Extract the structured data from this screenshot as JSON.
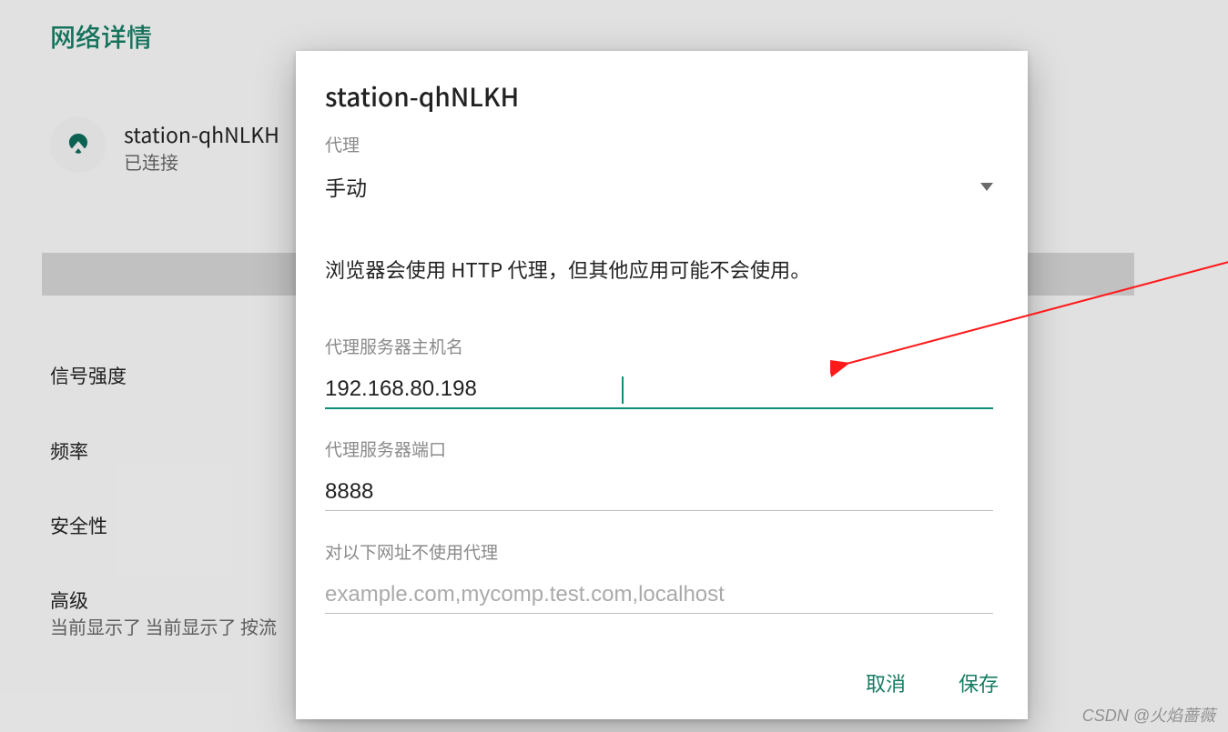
{
  "page": {
    "title": "网络详情",
    "network_name": "station-qhNLKH",
    "network_status": "已连接",
    "signal_strength_label": "信号强度",
    "frequency_label": "频率",
    "security_label": "安全性",
    "advanced_label": "高级",
    "advanced_sub": "当前显示了 当前显示了 按流"
  },
  "dialog": {
    "title": "station-qhNLKH",
    "proxy_label": "代理",
    "proxy_value": "手动",
    "info_text": "浏览器会使用 HTTP 代理，但其他应用可能不会使用。",
    "host_label": "代理服务器主机名",
    "host_value": "192.168.80.198",
    "port_label": "代理服务器端口",
    "port_value": "8888",
    "bypass_label": "对以下网址不使用代理",
    "bypass_placeholder": "example.com,mycomp.test.com,localhost",
    "cancel": "取消",
    "save": "保存"
  },
  "watermark": "CSDN @火焰蔷薇"
}
